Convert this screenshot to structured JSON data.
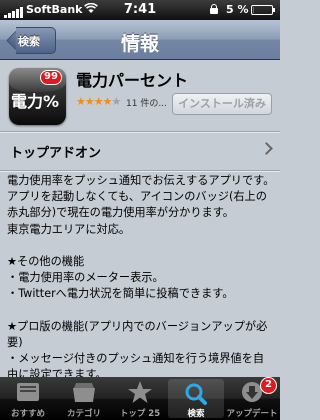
{
  "status_bar": {
    "carrier": "SoftBank",
    "time": "7:41",
    "battery_percent": "5 %",
    "battery_level": 0.05
  },
  "nav": {
    "back_label": "検索",
    "title": "情報"
  },
  "app": {
    "icon_text": "電力%",
    "icon_badge": "99",
    "name": "電力パーセント",
    "rating_stars": 4,
    "rating_max": 5,
    "rating_count": "11 件の...",
    "install_label": "インストール済み"
  },
  "addon": {
    "label": "トップアドオン"
  },
  "description": "電力使用率をプッシュ通知でお伝えするアプリです。\nアプリを起動しなくても、アイコンのバッジ(右上の赤丸部分)で現在の電力使用率が分かります。\n東京電力エリアに対応。\n\n★その他の機能\n・電力使用率のメーター表示。\n・Twitterへ電力状況を簡単に投稿できます。\n\n★プロ版の機能(アプリ内でのバージョンアップが必要)\n・メッセージ付きのプッシュ通知を行う境界値を自由に設定できます。\n・メッセージ付きのプッシュ通知の時刻帯",
  "tabbar": {
    "tabs": [
      {
        "label": "おすすめ",
        "icon": "featured-icon"
      },
      {
        "label": "カテゴリ",
        "icon": "categories-icon"
      },
      {
        "label": "トップ 25",
        "icon": "top25-star-icon"
      },
      {
        "label": "検索",
        "icon": "search-icon",
        "selected": true
      },
      {
        "label": "アップデート",
        "icon": "updates-icon",
        "badge": "2"
      }
    ]
  },
  "colors": {
    "badge_red": "#e0191f",
    "star_orange": "#f28f13",
    "nav_blue": "#6d7fa0"
  }
}
